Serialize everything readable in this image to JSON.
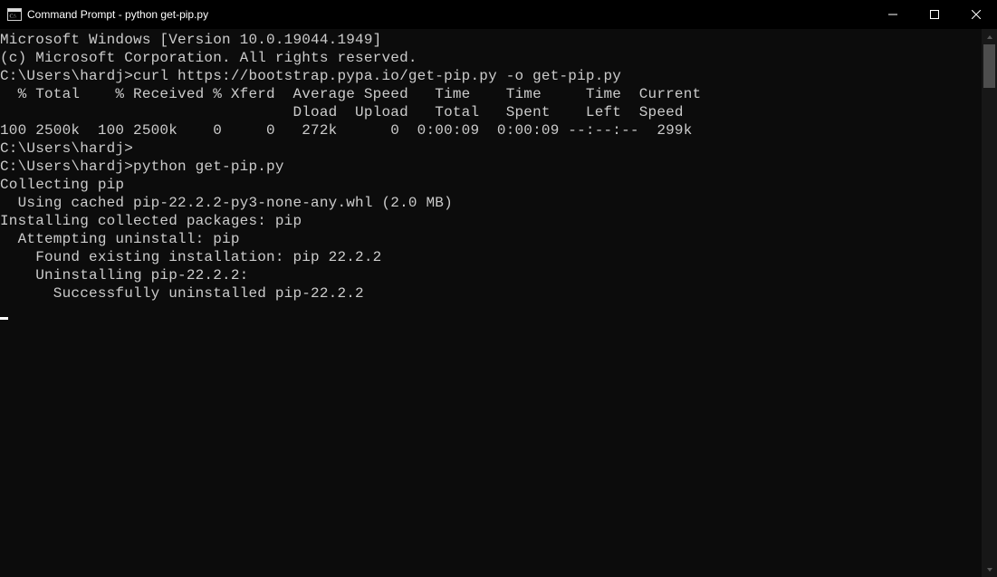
{
  "window": {
    "title": "Command Prompt - python  get-pip.py"
  },
  "terminal": {
    "lines": [
      "Microsoft Windows [Version 10.0.19044.1949]",
      "(c) Microsoft Corporation. All rights reserved.",
      "",
      "C:\\Users\\hardj>curl https://bootstrap.pypa.io/get-pip.py -o get-pip.py",
      "  % Total    % Received % Xferd  Average Speed   Time    Time     Time  Current",
      "                                 Dload  Upload   Total   Spent    Left  Speed",
      "100 2500k  100 2500k    0     0   272k      0  0:00:09  0:00:09 --:--:--  299k",
      "",
      "C:\\Users\\hardj>",
      "",
      "C:\\Users\\hardj>python get-pip.py",
      "Collecting pip",
      "  Using cached pip-22.2.2-py3-none-any.whl (2.0 MB)",
      "Installing collected packages: pip",
      "  Attempting uninstall: pip",
      "    Found existing installation: pip 22.2.2",
      "    Uninstalling pip-22.2.2:",
      "      Successfully uninstalled pip-22.2.2"
    ]
  }
}
